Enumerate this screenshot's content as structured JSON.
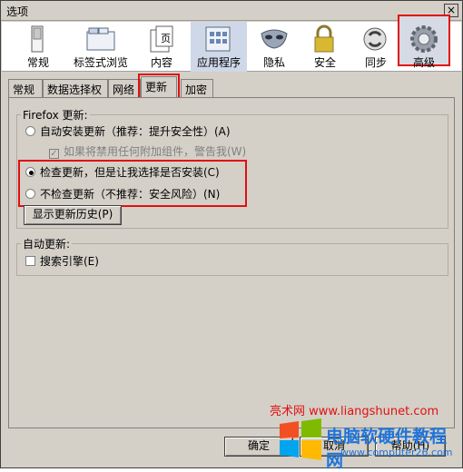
{
  "window": {
    "title": "选项",
    "close_glyph": "×"
  },
  "toolbar": {
    "items": [
      {
        "label": "常规",
        "icon": "switch-icon"
      },
      {
        "label": "标签式浏览",
        "icon": "tabs-window-icon"
      },
      {
        "label": "内容",
        "icon": "page-icon"
      },
      {
        "label": "应用程序",
        "icon": "applications-icon"
      },
      {
        "label": "隐私",
        "icon": "mask-icon"
      },
      {
        "label": "安全",
        "icon": "padlock-icon"
      },
      {
        "label": "同步",
        "icon": "sync-icon"
      },
      {
        "label": "高级",
        "icon": "gear-icon"
      }
    ],
    "selected": "高级"
  },
  "tabs": [
    "常规",
    "数据选择权",
    "网络",
    "更新",
    "加密"
  ],
  "active_tab": "更新",
  "firefox_update": {
    "legend": "Firefox 更新:",
    "auto_install": "自动安装更新（推荐：提升安全性）(A)",
    "warn_disabled_addons": "如果将禁用任何附加组件，警告我(W)",
    "check_but_ask": "检查更新，但是让我选择是否安装(C)",
    "never_check": "不检查更新（不推荐：安全风险）(N)",
    "show_history_button": "显示更新历史(P)",
    "selected_option": "check_but_ask"
  },
  "auto_update": {
    "legend": "自动更新:",
    "search_engines": "搜索引擎(E)",
    "search_engines_checked": false
  },
  "buttons": {
    "ok": "确定",
    "cancel": "取消",
    "help": "帮助(H)"
  },
  "watermark": {
    "site": "亮术网 www.liangshunet.com",
    "brand": "电脑软硬件教程网",
    "url": "www.computer26.com"
  },
  "colors": {
    "highlight_red": "#e01010",
    "dialog_bg": "#d4d0c8",
    "brand_blue": "#1f74d8"
  }
}
